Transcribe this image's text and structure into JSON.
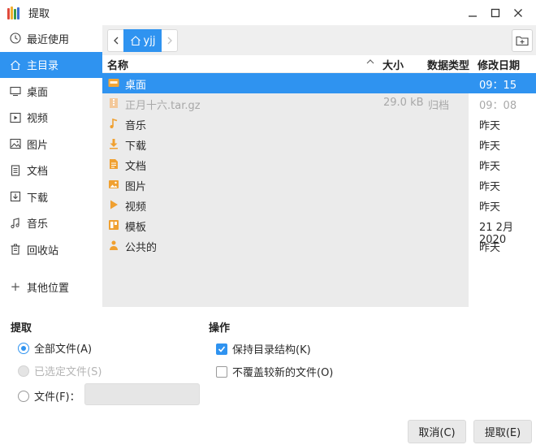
{
  "window": {
    "title": "提取",
    "app_icon": "archive-manager-icon"
  },
  "sidebar": {
    "items": [
      {
        "label": "最近使用",
        "icon": "clock-icon"
      },
      {
        "label": "主目录",
        "icon": "home-icon",
        "active": true
      },
      {
        "label": "桌面",
        "icon": "desktop-icon"
      },
      {
        "label": "视频",
        "icon": "video-icon"
      },
      {
        "label": "图片",
        "icon": "picture-icon"
      },
      {
        "label": "文档",
        "icon": "document-icon"
      },
      {
        "label": "下载",
        "icon": "download-icon"
      },
      {
        "label": "音乐",
        "icon": "music-icon"
      },
      {
        "label": "回收站",
        "icon": "trash-icon"
      }
    ],
    "other": "其他位置"
  },
  "pathbar": {
    "current": "yjj"
  },
  "filelist": {
    "columns": {
      "name": "名称",
      "size": "大小",
      "type": "数据类型",
      "modified": "修改日期"
    },
    "rows": [
      {
        "name": "桌面",
        "size": "",
        "type": "",
        "modified": "09：15",
        "icon": "desktop-folder-icon",
        "selected": true
      },
      {
        "name": "正月十六.tar.gz",
        "size": "29.0 kB",
        "type": "归档",
        "modified": "09：08",
        "icon": "archive-file-icon",
        "dim": true
      },
      {
        "name": "音乐",
        "size": "",
        "type": "",
        "modified": "昨天",
        "icon": "music-folder-icon"
      },
      {
        "name": "下载",
        "size": "",
        "type": "",
        "modified": "昨天",
        "icon": "download-folder-icon"
      },
      {
        "name": "文档",
        "size": "",
        "type": "",
        "modified": "昨天",
        "icon": "document-folder-icon"
      },
      {
        "name": "图片",
        "size": "",
        "type": "",
        "modified": "昨天",
        "icon": "picture-folder-icon"
      },
      {
        "name": "视频",
        "size": "",
        "type": "",
        "modified": "昨天",
        "icon": "video-folder-icon"
      },
      {
        "name": "模板",
        "size": "",
        "type": "",
        "modified": "21 2月 2020",
        "icon": "template-folder-icon"
      },
      {
        "name": "公共的",
        "size": "",
        "type": "",
        "modified": "昨天",
        "icon": "public-folder-icon"
      }
    ]
  },
  "extract": {
    "title": "提取",
    "all_files": "全部文件(A)",
    "selected_files": "已选定文件(S)",
    "files": "文件(F)：",
    "files_value": "",
    "selected_option": "all_files"
  },
  "actions": {
    "title": "操作",
    "keep_structure": "保持目录结构(K)",
    "keep_structure_checked": true,
    "no_overwrite": "不覆盖较新的文件(O)",
    "no_overwrite_checked": false
  },
  "buttons": {
    "cancel": "取消(C)",
    "extract": "提取(E)"
  },
  "colors": {
    "accent": "#2f93f0",
    "folder": "#f0a030"
  }
}
